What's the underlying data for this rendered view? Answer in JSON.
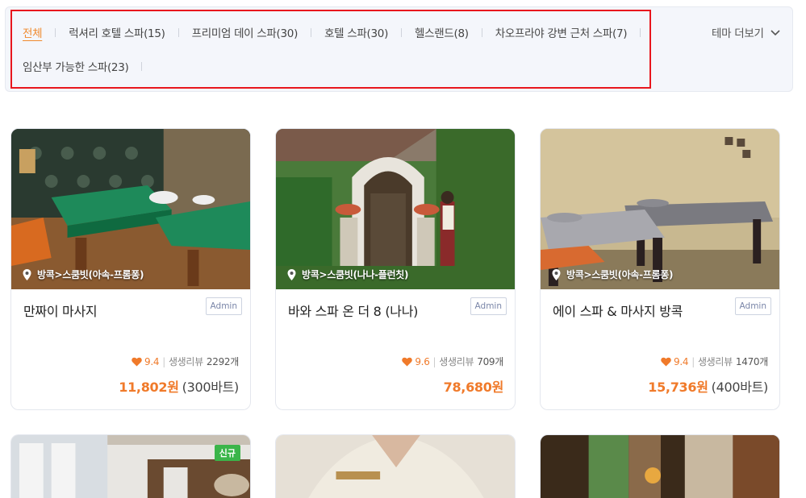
{
  "filters": {
    "tabs": [
      {
        "label": "전체",
        "active": true
      },
      {
        "label": "럭셔리 호텔 스파(15)"
      },
      {
        "label": "프리미엄 데이 스파(30)"
      },
      {
        "label": "호텔 스파(30)"
      },
      {
        "label": "헬스랜드(8)"
      },
      {
        "label": "차오프라야 강변 근처 스파(7)"
      },
      {
        "label": "임산부 가능한 스파(23)"
      }
    ],
    "more_label": "테마 더보기",
    "more_icon": "chevron-down-icon"
  },
  "colors": {
    "accent": "#f08a2e",
    "price": "#f07a2a",
    "highlight": "#e8161d",
    "new_badge": "#3bb54a"
  },
  "cards": [
    {
      "location": "방콕>스쿰빗(아속-프롬퐁)",
      "title": "만짜이 마사지",
      "badge": "Admin",
      "score": "9.4",
      "review_label": "생생리뷰",
      "review_count": "2292개",
      "price_krw": "11,802원",
      "price_thb": "(300바트)"
    },
    {
      "location": "방콕>스쿰빗(나나-플런칫)",
      "title": "바와 스파 온 더 8 (나나)",
      "badge": "Admin",
      "score": "9.6",
      "review_label": "생생리뷰",
      "review_count": "709개",
      "price_krw": "78,680원",
      "price_thb": ""
    },
    {
      "location": "방콕>스쿰빗(아속-프롬퐁)",
      "title": "에이 스파 & 마사지 방콕",
      "badge": "Admin",
      "score": "9.4",
      "review_label": "생생리뷰",
      "review_count": "1470개",
      "price_krw": "15,736원",
      "price_thb": "(400바트)"
    }
  ],
  "bottom_cards": [
    {
      "badge": "신규"
    },
    {},
    {}
  ]
}
